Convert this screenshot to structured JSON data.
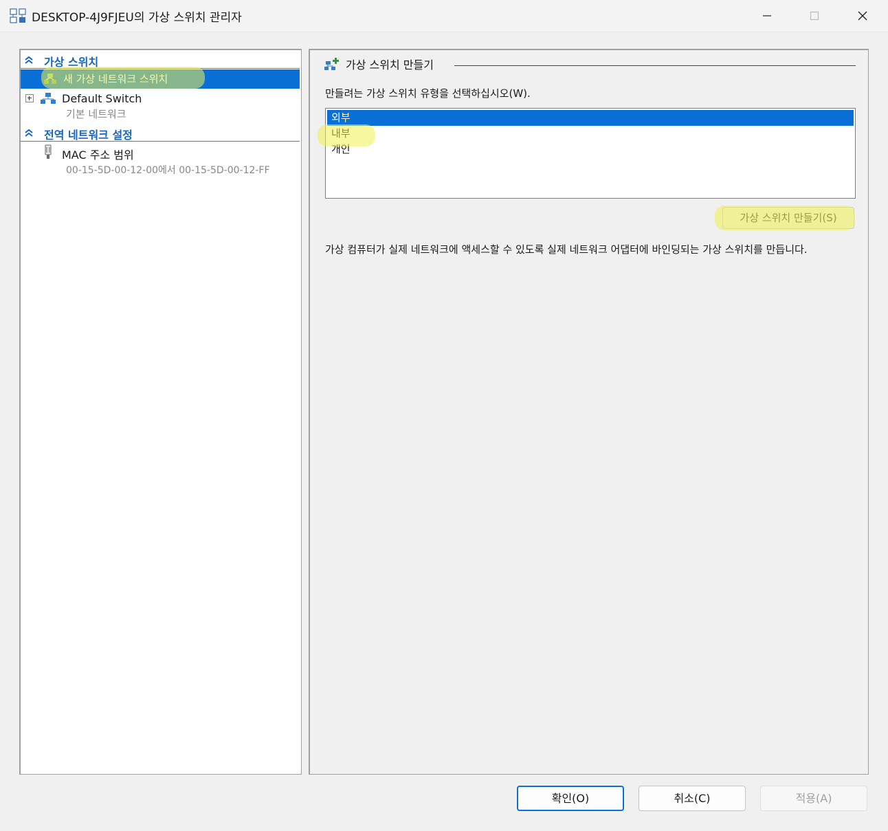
{
  "window": {
    "title": "DESKTOP-4J9FJEU의 가상 스위치 관리자",
    "minimize_glyph": "—",
    "close_glyph": "✕"
  },
  "left_pane": {
    "sections": [
      {
        "label": "가상 스위치",
        "items": [
          {
            "label": "새 가상 네트워크 스위치",
            "selected": true,
            "icon": "new-switch-icon"
          },
          {
            "label": "Default Switch",
            "sublabel": "기본 네트워크",
            "icon": "network-switch-icon"
          }
        ]
      },
      {
        "label": "전역 네트워크 설정",
        "items": [
          {
            "label": "MAC 주소 범위",
            "sublabel": "00-15-5D-00-12-00에서 00-15-5D-00-12-FF",
            "icon": "mac-range-icon"
          }
        ]
      }
    ]
  },
  "right_pane": {
    "group_title": "가상 스위치 만들기",
    "prompt": "만들려는 가상 스위치 유형을 선택하십시오(W).",
    "switch_types": [
      "외부",
      "내부",
      "개인"
    ],
    "selected_type": "외부",
    "create_button": "가상 스위치 만들기(S)",
    "description": "가상 컴퓨터가 실제 네트워크에 액세스할 수 있도록 실제 네트워크 어댑터에 바인딩되는 가상 스위치를 만듭니다."
  },
  "buttons": {
    "ok": "확인(O)",
    "cancel": "취소(C)",
    "apply": "적용(A)"
  },
  "colors": {
    "selection": "#0a6fd6",
    "section_header": "#1565c0",
    "highlight": "#f0f050"
  }
}
